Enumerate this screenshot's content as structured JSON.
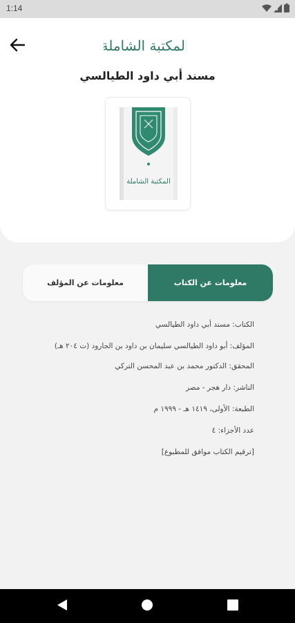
{
  "status_bar": {
    "time": "1:14"
  },
  "header": {
    "logo_text": "المكتبة الشاملة",
    "book_title": "مسند أبي داود الطيالسي"
  },
  "cover": {
    "label": "المكتبة الشاملة"
  },
  "tabs": {
    "book_info": "معلومات عن الكتاب",
    "author_info": "معلومات عن المؤلف"
  },
  "info": {
    "book": "الكتاب: مسند أبي داود الطيالسي",
    "author": "المؤلف: أبو داود الطيالسي سليمان بن داود بن الجارود (ت ٢٠٤ هـ)",
    "editor": "المحقق: الدكتور محمد بن عبد المحسن التركي",
    "publisher": "الناشر: دار هجر - مصر",
    "edition": "الطبعة: الأولى، ١٤١٩ هـ - ١٩٩٩ م",
    "volumes": "عدد الأجزاء: ٤",
    "note": "[ترقيم الكتاب موافق للمطبوع]"
  },
  "colors": {
    "accent": "#2f7a66",
    "header_bg": "#ffffff",
    "page_bg": "#f2f2f2"
  },
  "icons": {
    "back": "arrow-left-icon",
    "wifi": "wifi-icon",
    "signal": "signal-icon",
    "battery": "battery-icon",
    "nav_back": "triangle-back-icon",
    "nav_home": "circle-home-icon",
    "nav_recents": "square-recents-icon"
  }
}
